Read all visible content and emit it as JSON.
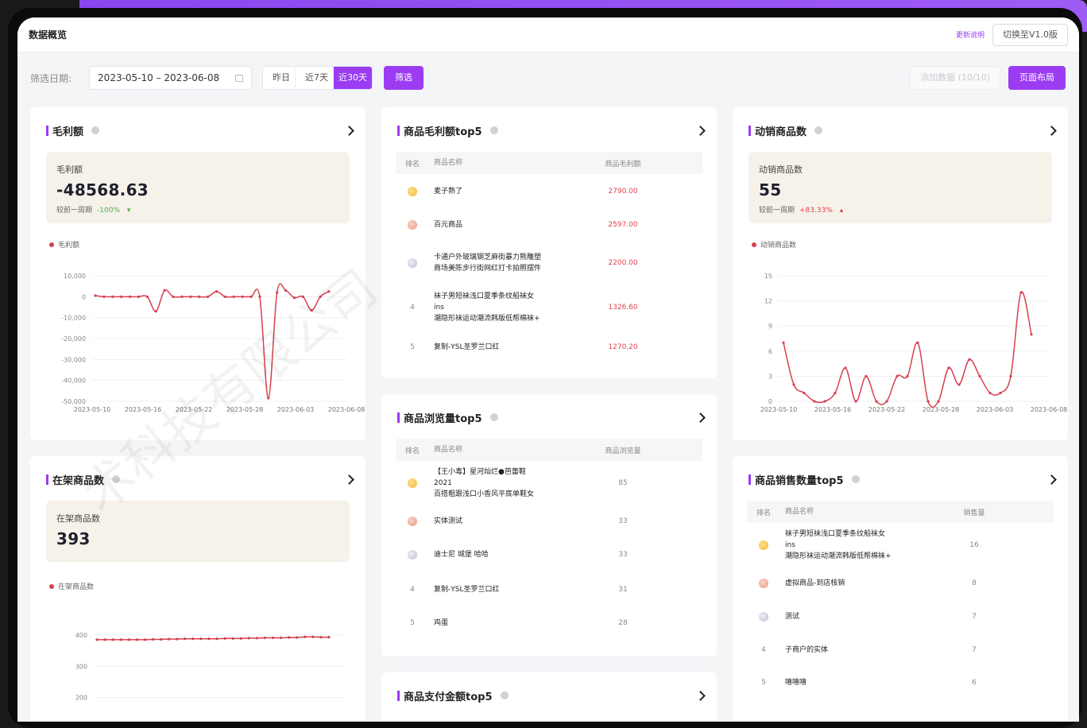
{
  "header": {
    "title": "数据概览",
    "update_note": "更新说明",
    "switch_version": "切换至V1.0版"
  },
  "filter": {
    "label": "筛选日期:",
    "date_range": "2023-05-10 – 2023-06-08",
    "quick": [
      "昨日",
      "近7天",
      "近30天"
    ],
    "quick_selected": "近30天",
    "filter_button": "筛选",
    "add_data": "添加数据 (10/10)",
    "layout_button": "页面布局"
  },
  "colors": {
    "accent": "#9b3cf2",
    "series": "#d6404e",
    "kpi_bg": "#f6f2ea",
    "down": "#4caf50",
    "up": "#e2414f"
  },
  "watermark": "术科技有限公司",
  "cards": {
    "gross_profit": {
      "title": "毛利额",
      "kpi_label": "毛利额",
      "kpi_value": "-48568.63",
      "compare_label": "较前一周期",
      "compare_value": "-100%",
      "compare_dir": "down",
      "legend": "毛利额"
    },
    "active_goods": {
      "title": "动销商品数",
      "kpi_label": "动销商品数",
      "kpi_value": "55",
      "compare_label": "较前一周期",
      "compare_value": "+83.33%",
      "compare_dir": "up",
      "legend": "动销商品数"
    },
    "onshelf_goods": {
      "title": "在架商品数",
      "kpi_label": "在架商品数",
      "kpi_value": "393",
      "legend": "在架商品数"
    },
    "profit_top5": {
      "title": "商品毛利额top5",
      "headers": [
        "排名",
        "商品名称",
        "商品毛利额"
      ],
      "rows": [
        {
          "rank": "1",
          "name": "麦子熟了",
          "value": "2790.00"
        },
        {
          "rank": "2",
          "name": "百元商品",
          "value": "2597.00"
        },
        {
          "rank": "3",
          "name": "卡通户外玻璃钢芝麻街暴力熊雕塑\n商场美陈步行街网红打卡拍照摆件",
          "value": "2200.00"
        },
        {
          "rank": "4",
          "name": "袜子男短袜浅口夏季条纹船袜女ins\n潮隐形袜运动潮流韩版低帮棉袜+",
          "value": "1326.60"
        },
        {
          "rank": "5",
          "name": "复制-YSL圣罗兰口红",
          "value": "1270.20"
        }
      ]
    },
    "views_top5": {
      "title": "商品浏览量top5",
      "headers": [
        "排名",
        "商品名称",
        "商品浏览量"
      ],
      "rows": [
        {
          "rank": "1",
          "name": "【王小毒】星河灿烂●芭蕾鞋2021\n百搭粗跟浅口小香风平底单鞋女",
          "value": "85"
        },
        {
          "rank": "2",
          "name": "实体测试",
          "value": "33"
        },
        {
          "rank": "3",
          "name": "迪士尼 城堡 哈哈",
          "value": "33"
        },
        {
          "rank": "4",
          "name": "复制-YSL圣罗兰口红",
          "value": "31"
        },
        {
          "rank": "5",
          "name": "鸡蛋",
          "value": "28"
        }
      ]
    },
    "pay_top5": {
      "title": "商品支付金额top5"
    },
    "sales_top5": {
      "title": "商品销售数量top5",
      "headers": [
        "排名",
        "商品名称",
        "销售量"
      ],
      "rows": [
        {
          "rank": "1",
          "name": "袜子男短袜浅口夏季条纹船袜女ins\n潮隐形袜运动潮流韩版低帮棉袜+",
          "value": "16"
        },
        {
          "rank": "2",
          "name": "虚拟商品-到店核销",
          "value": "8"
        },
        {
          "rank": "3",
          "name": "测试",
          "value": "7"
        },
        {
          "rank": "4",
          "name": "子商户的实体",
          "value": "7"
        },
        {
          "rank": "5",
          "name": "嘻嘻嘻",
          "value": "6"
        }
      ]
    }
  },
  "chart_data": [
    {
      "type": "line",
      "id": "gross_profit",
      "x_ticks": [
        "2023-05-10",
        "2023-05-16",
        "2023-05-22",
        "2023-05-28",
        "2023-06-03",
        "2023-06-08"
      ],
      "ylim": [
        -50000,
        10000
      ],
      "y_ticks": [
        10000,
        0,
        -10000,
        -20000,
        -30000,
        -40000,
        -50000
      ],
      "y_tick_labels": [
        "10,000",
        "0",
        "-10,000",
        "-20,000",
        "-30,000",
        "-40,000",
        "-50,000"
      ],
      "series": [
        {
          "name": "毛利额",
          "values": [
            500,
            0,
            0,
            0,
            0,
            0,
            0,
            -7000,
            3000,
            0,
            0,
            0,
            0,
            0,
            2500,
            0,
            0,
            0,
            0,
            0,
            -48500,
            2000,
            3000,
            -500,
            0,
            -6500,
            0,
            2500
          ]
        }
      ]
    },
    {
      "type": "line",
      "id": "active_goods",
      "x_ticks": [
        "2023-05-10",
        "2023-05-16",
        "2023-05-22",
        "2023-05-28",
        "2023-06-03",
        "2023-06-08"
      ],
      "ylim": [
        0,
        15
      ],
      "y_ticks": [
        15,
        12,
        9,
        6,
        3,
        0
      ],
      "series": [
        {
          "name": "动销商品数",
          "values": [
            7,
            2,
            1,
            0,
            0,
            1,
            4,
            0,
            3,
            0,
            0,
            3,
            3,
            7,
            0,
            0,
            4,
            2,
            5,
            3,
            1,
            1,
            3,
            13,
            8
          ]
        }
      ]
    },
    {
      "type": "line",
      "id": "onshelf_goods",
      "ylim": [
        100,
        400
      ],
      "y_ticks": [
        400,
        300,
        200,
        100
      ],
      "series": [
        {
          "name": "在架商品数",
          "values": [
            385,
            385,
            385,
            385,
            385,
            385,
            385,
            386,
            386,
            387,
            387,
            388,
            388,
            388,
            388,
            388,
            389,
            389,
            389,
            390,
            390,
            391,
            391,
            391,
            392,
            392,
            394,
            394,
            393,
            393
          ]
        }
      ]
    }
  ]
}
